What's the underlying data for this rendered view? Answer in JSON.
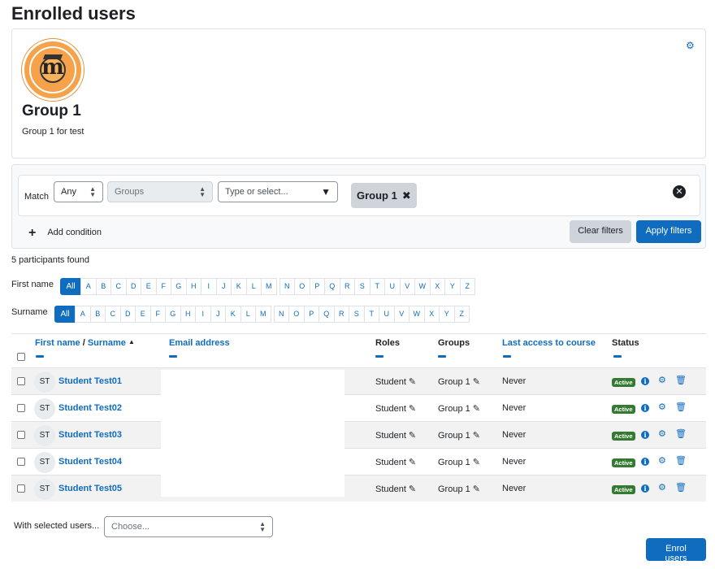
{
  "page": {
    "title": "Enrolled users"
  },
  "group": {
    "name": "Group 1",
    "description": "Group 1 for test",
    "logo_text": "m",
    "logo_icon": "moodle-powered-logo"
  },
  "filters": {
    "match_label": "Match",
    "match_value": "Any",
    "type_value": "Groups",
    "select_placeholder": "Type or select...",
    "selected_chip": "Group 1",
    "add_condition": "Add condition",
    "clear_button": "Clear filters",
    "apply_button": "Apply filters"
  },
  "participants_found": "5 participants found",
  "initials": {
    "first_name_label": "First name",
    "surname_label": "Surname",
    "all_label": "All",
    "letters": [
      "A",
      "B",
      "C",
      "D",
      "E",
      "F",
      "G",
      "H",
      "I",
      "J",
      "K",
      "L",
      "M",
      "N",
      "O",
      "P",
      "Q",
      "R",
      "S",
      "T",
      "U",
      "V",
      "W",
      "X",
      "Y",
      "Z"
    ]
  },
  "table": {
    "col_first_name": "First name",
    "col_sep": " / ",
    "col_surname": "Surname",
    "col_email": "Email address",
    "col_roles": "Roles",
    "col_groups": "Groups",
    "col_last_access": "Last access to course",
    "col_status": "Status",
    "rows": [
      {
        "initials": "ST",
        "name": "Student Test01",
        "role": "Student",
        "group": "Group 1",
        "last_access": "Never",
        "status": "Active"
      },
      {
        "initials": "ST",
        "name": "Student Test02",
        "role": "Student",
        "group": "Group 1",
        "last_access": "Never",
        "status": "Active"
      },
      {
        "initials": "ST",
        "name": "Student Test03",
        "role": "Student",
        "group": "Group 1",
        "last_access": "Never",
        "status": "Active"
      },
      {
        "initials": "ST",
        "name": "Student Test04",
        "role": "Student",
        "group": "Group 1",
        "last_access": "Never",
        "status": "Active"
      },
      {
        "initials": "ST",
        "name": "Student Test05",
        "role": "Student",
        "group": "Group 1",
        "last_access": "Never",
        "status": "Active"
      }
    ]
  },
  "bulk": {
    "label": "With selected users...",
    "placeholder": "Choose..."
  },
  "enrol_button": "Enrol users",
  "colors": {
    "primary": "#0f6cbf",
    "active_badge": "#357a32"
  }
}
